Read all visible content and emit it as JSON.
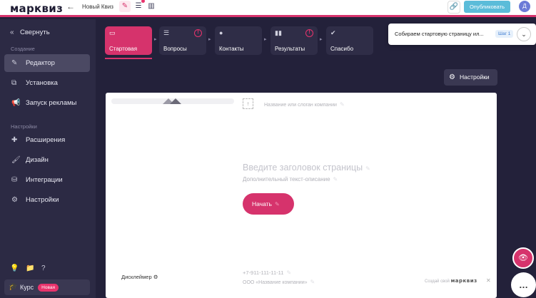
{
  "topbar": {
    "logo": "марквиз",
    "quiz_name": "Новый Квиз",
    "publish_label": "Опубликовать",
    "avatar_letter": "Д"
  },
  "sidebar": {
    "collapse_label": "Свернуть",
    "section_create": "Создание",
    "section_settings": "Настройки",
    "items": [
      {
        "label": "Редактор",
        "icon": "pencil-icon",
        "active": true
      },
      {
        "label": "Установка",
        "icon": "install-icon"
      },
      {
        "label": "Запуск рекламы",
        "icon": "megaphone-icon"
      },
      {
        "label": "Расширения",
        "icon": "puzzle-icon"
      },
      {
        "label": "Дизайн",
        "icon": "brush-icon"
      },
      {
        "label": "Интеграции",
        "icon": "integrations-icon"
      },
      {
        "label": "Настройки",
        "icon": "gear-icon"
      }
    ],
    "course_label": "Курс",
    "course_badge": "Новая"
  },
  "steps": [
    {
      "label": "Стартовая",
      "active": true
    },
    {
      "label": "Вопросы",
      "warning": true
    },
    {
      "label": "Контакты"
    },
    {
      "label": "Результаты",
      "warning": true
    },
    {
      "label": "Спасибо"
    }
  ],
  "onboarding": {
    "text": "Собираем стартовую страницу ил...",
    "step_badge": "Шаг 1"
  },
  "settings_button": "Настройки",
  "canvas": {
    "slogan_placeholder": "Название или слоган компании",
    "title_placeholder": "Введите заголовок страницы",
    "subtitle_placeholder": "Дополнительный текст-описание",
    "start_button": "Начать",
    "disclaimer": "Дисклеймер",
    "phone": "+7-911-111-11-11",
    "company": "ООО «Название компании»",
    "powered_text": "Создай свой",
    "powered_brand": "марквиз"
  },
  "colors": {
    "accent": "#d6336c",
    "sidebar_bg": "#2c2a44",
    "page_bg": "#23213a",
    "publish": "#5bbcd9"
  }
}
